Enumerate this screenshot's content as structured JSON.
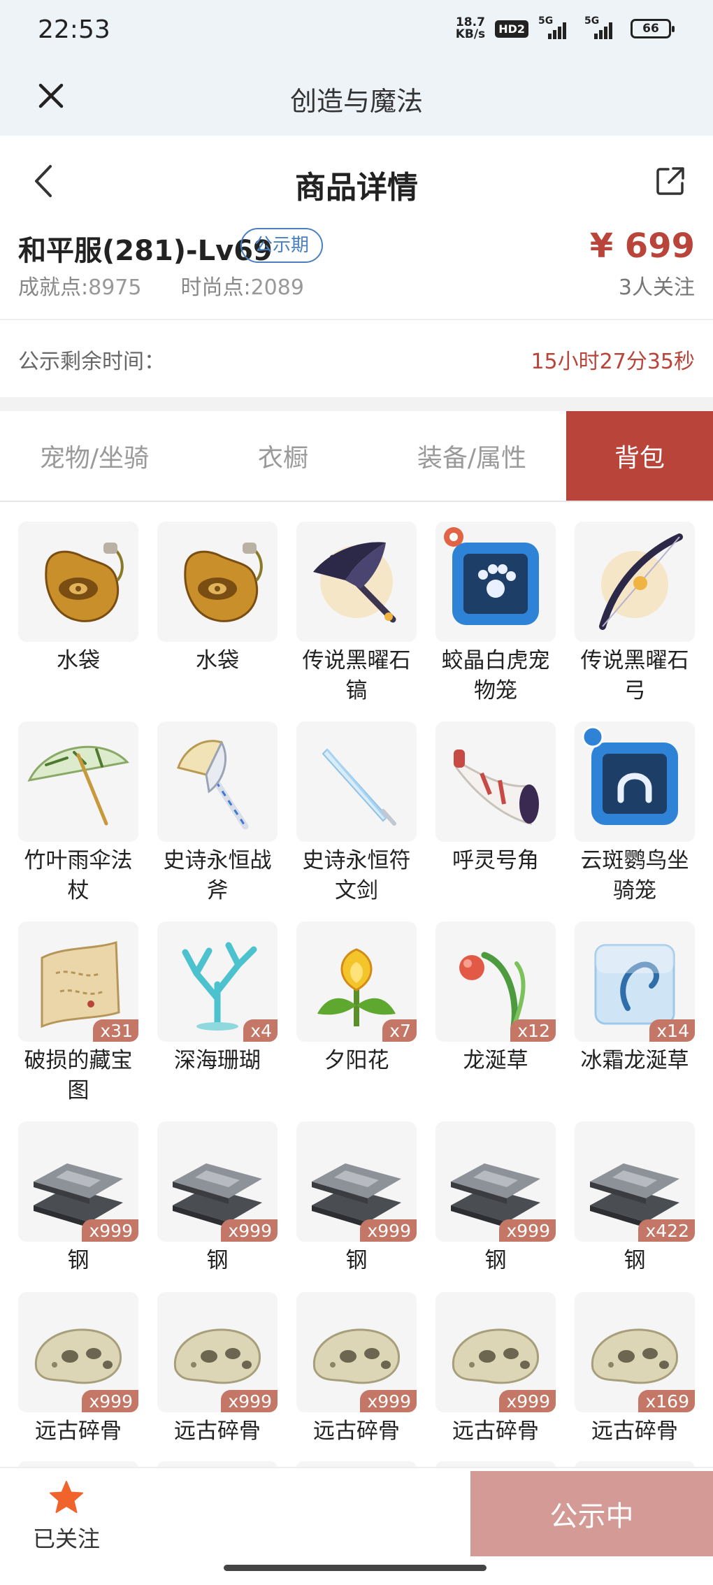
{
  "status_bar": {
    "time": "22:53",
    "net_speed_value": "18.7",
    "net_speed_unit": "KB/s",
    "hd": "HD2",
    "signal_1": "5G",
    "signal_2": "5G",
    "battery": "66"
  },
  "app_header": {
    "title": "创造与魔法"
  },
  "page_header": {
    "title": "商品详情"
  },
  "summary": {
    "account_name": "和平服(281)-Lv69",
    "tag": "公示期",
    "achievement_label": "成就点:",
    "achievement_value": "8975",
    "fashion_label": "时尚点:",
    "fashion_value": "2089",
    "price": "¥ 699",
    "followers": "3人关注"
  },
  "remaining": {
    "label": "公示剩余时间：",
    "value": "15小时27分35秒"
  },
  "tabs": [
    {
      "label": "宠物/坐骑",
      "active": false
    },
    {
      "label": "衣橱",
      "active": false
    },
    {
      "label": "装备/属性",
      "active": false
    },
    {
      "label": "背包",
      "active": true
    }
  ],
  "items": [
    {
      "name": "水袋",
      "qty": "",
      "icon": "water-bag-icon"
    },
    {
      "name": "水袋",
      "qty": "",
      "icon": "water-bag-icon"
    },
    {
      "name": "传说黑曜石镐",
      "qty": "",
      "icon": "obsidian-pickaxe-icon"
    },
    {
      "name": "蛟晶白虎宠物笼",
      "qty": "",
      "icon": "pet-cage-icon"
    },
    {
      "name": "传说黑曜石弓",
      "qty": "",
      "icon": "obsidian-bow-icon"
    },
    {
      "name": "竹叶雨伞法杖",
      "qty": "",
      "icon": "bamboo-umbrella-icon"
    },
    {
      "name": "史诗永恒战斧",
      "qty": "",
      "icon": "battle-axe-icon"
    },
    {
      "name": "史诗永恒符文剑",
      "qty": "",
      "icon": "rune-sword-icon"
    },
    {
      "name": "呼灵号角",
      "qty": "",
      "icon": "horn-icon"
    },
    {
      "name": "云斑鹦鸟坐骑笼",
      "qty": "",
      "icon": "mount-cage-icon"
    },
    {
      "name": "破损的藏宝图",
      "qty": "x31",
      "icon": "treasure-map-icon"
    },
    {
      "name": "深海珊瑚",
      "qty": "x4",
      "icon": "coral-icon"
    },
    {
      "name": "夕阳花",
      "qty": "x7",
      "icon": "sunset-flower-icon"
    },
    {
      "name": "龙涎草",
      "qty": "x12",
      "icon": "dragon-grass-icon"
    },
    {
      "name": "冰霜龙涎草",
      "qty": "x14",
      "icon": "frost-grass-icon"
    },
    {
      "name": "钢",
      "qty": "x999",
      "icon": "steel-ingot-icon"
    },
    {
      "name": "钢",
      "qty": "x999",
      "icon": "steel-ingot-icon"
    },
    {
      "name": "钢",
      "qty": "x999",
      "icon": "steel-ingot-icon"
    },
    {
      "name": "钢",
      "qty": "x999",
      "icon": "steel-ingot-icon"
    },
    {
      "name": "钢",
      "qty": "x422",
      "icon": "steel-ingot-icon"
    },
    {
      "name": "远古碎骨",
      "qty": "x999",
      "icon": "ancient-bone-icon"
    },
    {
      "name": "远古碎骨",
      "qty": "x999",
      "icon": "ancient-bone-icon"
    },
    {
      "name": "远古碎骨",
      "qty": "x999",
      "icon": "ancient-bone-icon"
    },
    {
      "name": "远古碎骨",
      "qty": "x999",
      "icon": "ancient-bone-icon"
    },
    {
      "name": "远古碎骨",
      "qty": "x169",
      "icon": "ancient-bone-icon"
    }
  ],
  "bottom_bar": {
    "follow_label": "已关注",
    "status_button": "公示中"
  },
  "colors": {
    "accent": "#b9443a",
    "tag_blue": "#4a7fc1",
    "qty_badge": "#c47766",
    "status_button": "#d49a95",
    "star": "#f0642c"
  }
}
